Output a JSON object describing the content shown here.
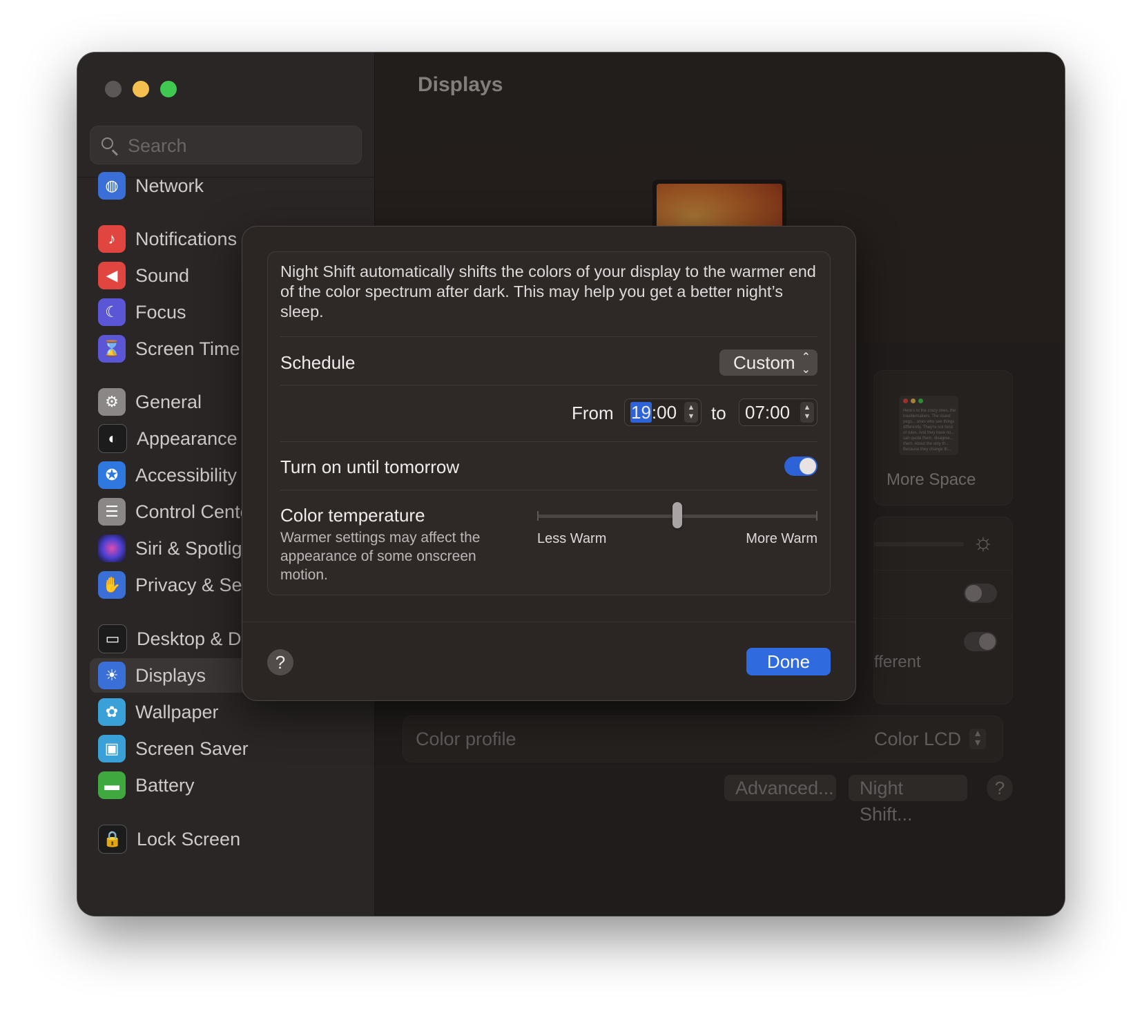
{
  "window": {
    "title": "Displays"
  },
  "sidebar": {
    "search_placeholder": "Search",
    "items": [
      {
        "label": "Network",
        "icon": "globe-icon",
        "color": "#3a6fd8"
      },
      {
        "label": "Notifications",
        "icon": "bell-icon",
        "color": "#e0463f"
      },
      {
        "label": "Sound",
        "icon": "speaker-icon",
        "color": "#e0463f"
      },
      {
        "label": "Focus",
        "icon": "moon-icon",
        "color": "#5b56d6"
      },
      {
        "label": "Screen Time",
        "icon": "hourglass-icon",
        "color": "#5b56d6"
      },
      {
        "label": "General",
        "icon": "gear-icon",
        "color": "#8a8786"
      },
      {
        "label": "Appearance",
        "icon": "appearance-icon",
        "color": "#1c1c1c"
      },
      {
        "label": "Accessibility",
        "icon": "accessibility-icon",
        "color": "#2f78e0"
      },
      {
        "label": "Control Cente",
        "icon": "control-center-icon",
        "color": "#8a8786"
      },
      {
        "label": "Siri & Spotligh",
        "icon": "siri-icon",
        "color": "#9a3fd0"
      },
      {
        "label": "Privacy & Sec",
        "icon": "hand-icon",
        "color": "#3a6fd8"
      },
      {
        "label": "Desktop & Do",
        "icon": "dock-icon",
        "color": "#1c1c1c"
      },
      {
        "label": "Displays",
        "icon": "sun-icon",
        "color": "#3a6fd8"
      },
      {
        "label": "Wallpaper",
        "icon": "flower-icon",
        "color": "#3aa0d8"
      },
      {
        "label": "Screen Saver",
        "icon": "screen-saver-icon",
        "color": "#3aa0d8"
      },
      {
        "label": "Battery",
        "icon": "battery-icon",
        "color": "#3fa83f"
      },
      {
        "label": "Lock Screen",
        "icon": "lock-icon",
        "color": "#1c1c1c"
      }
    ]
  },
  "main": {
    "more_space_label": "More Space",
    "thumb_text": "Here's to the crazy ones, the troublemakers. The round pegs... ones who see things differently. They're not fond of rules. And they have no... can quote them, disagree... them. About the only th... Because they change th...",
    "different_text": "fferent",
    "color_profile": {
      "label": "Color profile",
      "value": "Color LCD"
    },
    "buttons": {
      "advanced": "Advanced...",
      "night_shift": "Night Shift...",
      "help": "?"
    }
  },
  "night_shift": {
    "description": "Night Shift automatically shifts the colors of your display to the warmer end of the color spectrum after dark. This may help you get a better night’s sleep.",
    "schedule_label": "Schedule",
    "schedule_value": "Custom",
    "from_label": "From",
    "from_hour": "19",
    "from_rest": ":00",
    "to_label": "to",
    "to_time": "07:00",
    "manual_label": "Turn on until tomorrow",
    "manual_on": true,
    "temp_label": "Color temperature",
    "temp_sub": "Warmer settings may affect the appearance of some onscreen motion.",
    "temp_value": 0.5,
    "less_warm": "Less Warm",
    "more_warm": "More Warm",
    "help": "?",
    "done": "Done",
    "accent_color": "#2f6ade"
  }
}
